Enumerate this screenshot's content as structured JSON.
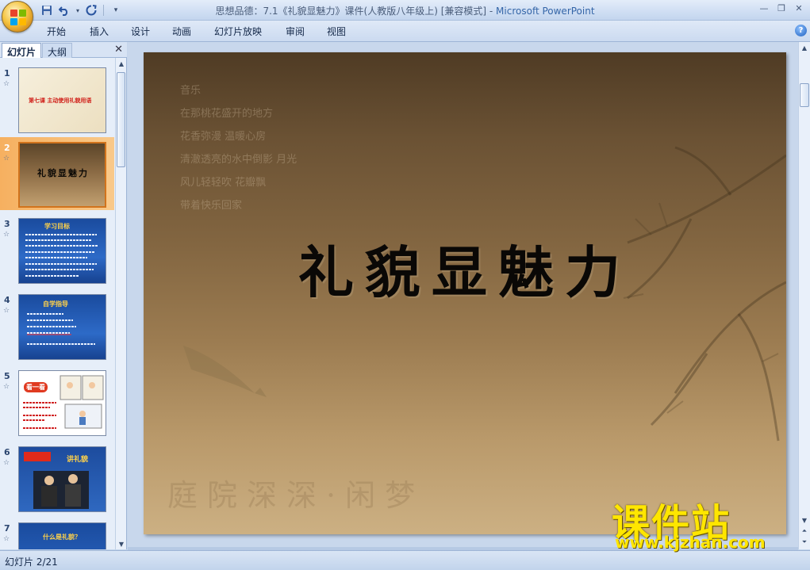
{
  "window": {
    "title": "思想品德：7.1《礼貌显魅力》课件(人教版八年级上) [兼容模式]",
    "title_separator": " - ",
    "app_name": "Microsoft PowerPoint"
  },
  "quick_access": [
    "save-icon",
    "undo-icon",
    "redo-icon",
    "customize-icon"
  ],
  "ribbon": {
    "tabs": [
      "开始",
      "插入",
      "设计",
      "动画",
      "幻灯片放映",
      "审阅",
      "视图"
    ],
    "help": "?"
  },
  "left_pane": {
    "tabs": {
      "slides": "幻灯片",
      "outline": "大纲"
    },
    "close": "✕",
    "anim_marker": "☆",
    "thumbnails": [
      {
        "num": "1",
        "text": "第七课  主动使用礼貌用语"
      },
      {
        "num": "2",
        "text": "礼貌显魅力"
      },
      {
        "num": "3",
        "text": "学习目标"
      },
      {
        "num": "4",
        "text": "自学指导"
      },
      {
        "num": "5",
        "text": "看一看"
      },
      {
        "num": "6",
        "text": "讲礼貌"
      },
      {
        "num": "7",
        "text": "什么是礼貌？"
      }
    ],
    "selected": "2"
  },
  "slide": {
    "title": "礼貌显魅力",
    "faded_lines": [
      "音乐",
      "在那桃花盛开的地方",
      "花香弥漫 温暖心房",
      "清澈透亮的水中倒影 月光",
      "风儿轻轻吹 花瓣飘",
      "带着快乐回家"
    ],
    "seal_text": "庭院深深·闲梦"
  },
  "watermark": {
    "brand": "课件站",
    "url": "www.kjzhan.com"
  },
  "statusbar": {
    "slide_position": "幻灯片 2/21"
  },
  "colors": {
    "accent": "#f6b060",
    "ribbon": "#cbdaf0",
    "watermark": "#ffe600"
  }
}
